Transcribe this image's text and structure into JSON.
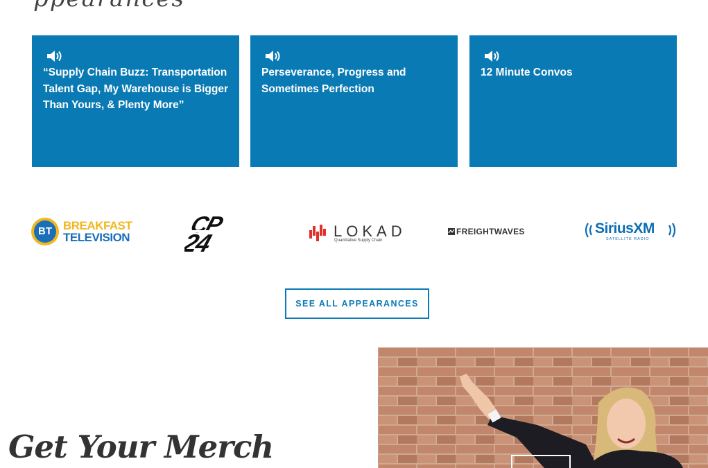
{
  "header": {
    "script_heading_fragment": "ppearances"
  },
  "podcasts": [
    {
      "icon": "speaker-icon",
      "title": "“Supply Chain Buzz: Transportation Talent Gap, My Warehouse is Bigger Than Yours, & Plenty More”"
    },
    {
      "icon": "speaker-icon",
      "title": "Perseverance, Progress and Sometimes Perfection"
    },
    {
      "icon": "speaker-icon",
      "title": "12 Minute Convos"
    }
  ],
  "logos": {
    "bt": {
      "badge": "BT",
      "line1": "BREAKFAST",
      "line2": "TELEVISION"
    },
    "cp24": {
      "text": "CP24"
    },
    "lokad": {
      "name": "LOKAD",
      "tagline": "Quantitative Supply Chain"
    },
    "freightwaves": {
      "text": "FREIGHTWAVES"
    },
    "siriusxm": {
      "name": "SiriusXM",
      "tagline": "SATELLITE RADIO"
    }
  },
  "cta": {
    "see_all_label": "SEE ALL APPEARANCES"
  },
  "merch": {
    "heading": "Get Your Merch"
  },
  "colors": {
    "accent": "#0a7ab5",
    "bt_yellow": "#f2b61f",
    "bt_blue": "#1a6fb8",
    "sirius_blue": "#0b6eb5",
    "lokad_red": "#e0322c"
  }
}
